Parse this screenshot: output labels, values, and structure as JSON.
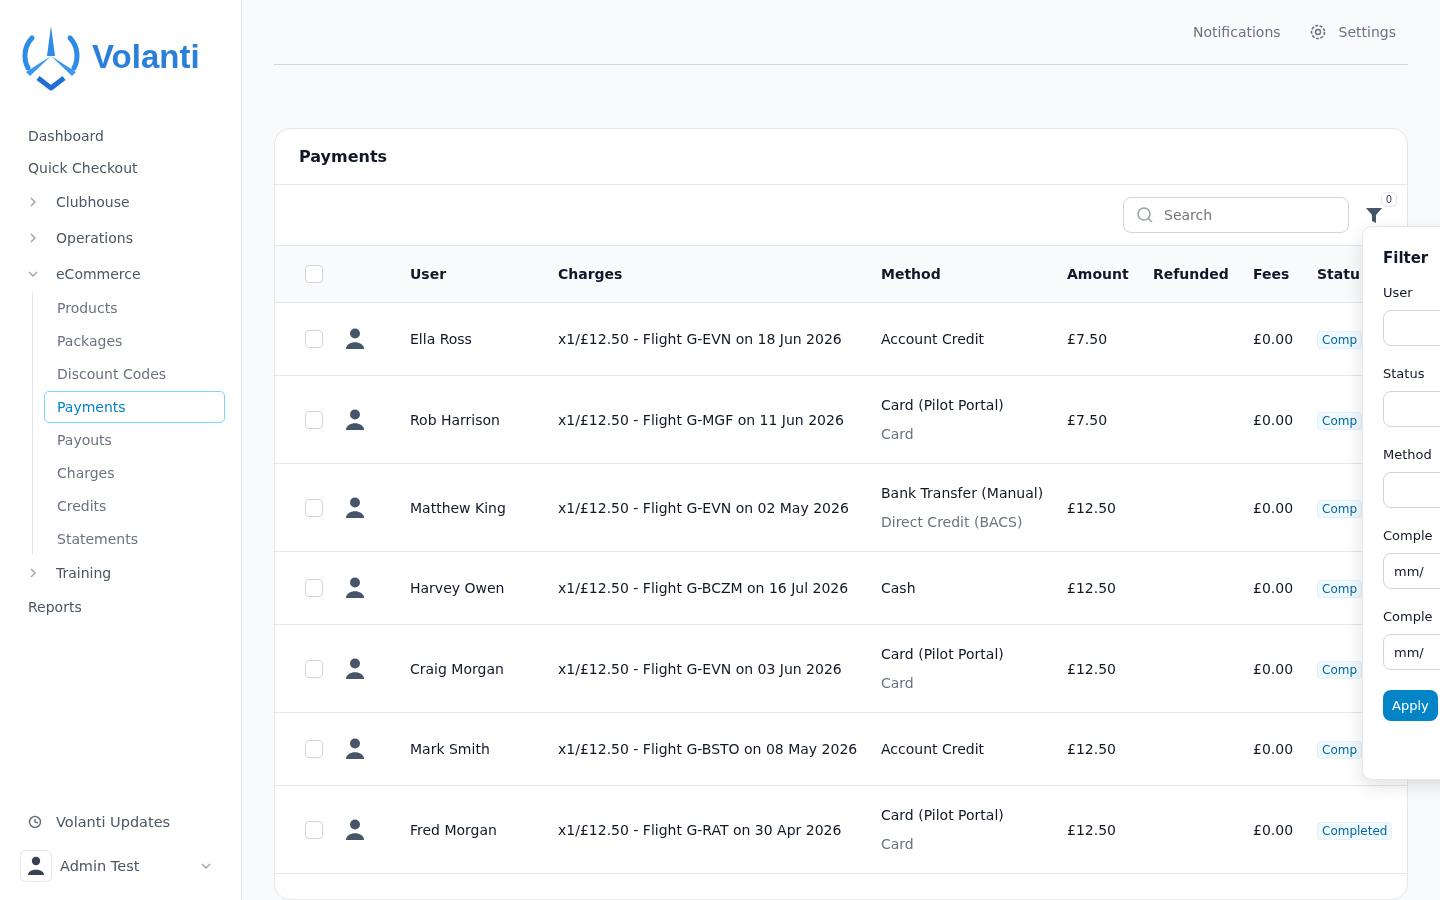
{
  "brand": {
    "name": "Volanti"
  },
  "topbar": {
    "links": [
      {
        "label": "Notifications",
        "kind": "plain"
      },
      {
        "label": "Settings",
        "kind": "gear"
      }
    ]
  },
  "sidebar": {
    "items": [
      {
        "label": "Dashboard",
        "kind": "link"
      },
      {
        "label": "Quick Checkout",
        "kind": "link"
      },
      {
        "label": "Clubhouse",
        "kind": "group",
        "expanded": false
      },
      {
        "label": "Operations",
        "kind": "group",
        "expanded": false
      },
      {
        "label": "eCommerce",
        "kind": "group",
        "expanded": true,
        "children": [
          {
            "label": "Products",
            "selected": false
          },
          {
            "label": "Packages",
            "selected": false
          },
          {
            "label": "Discount Codes",
            "selected": false
          },
          {
            "label": "Payments",
            "selected": true
          },
          {
            "label": "Payouts",
            "selected": false
          },
          {
            "label": "Charges",
            "selected": false
          },
          {
            "label": "Credits",
            "selected": false
          },
          {
            "label": "Statements",
            "selected": false
          }
        ]
      },
      {
        "label": "Training",
        "kind": "group",
        "expanded": false
      },
      {
        "label": "Reports",
        "kind": "link"
      }
    ],
    "updates": "Volanti Updates",
    "user": "Admin Test"
  },
  "card": {
    "title": "Payments",
    "search": {
      "placeholder": "Search"
    },
    "filter_count": "0"
  },
  "table": {
    "select_all": {
      "checked": false
    },
    "columns": [
      "User",
      "Charges",
      "Method",
      "Amount",
      "Refunded",
      "Fees",
      "Statu"
    ],
    "rows": [
      {
        "checked": false,
        "user": "Ella Ross",
        "charges": "x1/£12.50 - Flight G-EVN on 18 Jun 2026",
        "method": "Account Credit",
        "amount": "£7.50",
        "fees": "£0.00",
        "status": "Comp"
      },
      {
        "checked": false,
        "user": "Rob Harrison",
        "charges": "x1/£12.50 - Flight G-MGF on 11 Jun 2026",
        "method": "Card (Pilot Portal)",
        "method_detail": "Card",
        "amount": "£7.50",
        "fees": "£0.00",
        "status": "Comp"
      },
      {
        "checked": false,
        "user": "Matthew King",
        "charges": "x1/£12.50 - Flight G-EVN on 02 May 2026",
        "method": "Bank Transfer (Manual)",
        "method_detail": "Direct Credit (BACS)",
        "amount": "£12.50",
        "fees": "£0.00",
        "status": "Comp"
      },
      {
        "checked": false,
        "user": "Harvey Owen",
        "charges": "x1/£12.50 - Flight G-BCZM on 16 Jul 2026",
        "method": "Cash",
        "amount": "£12.50",
        "fees": "£0.00",
        "status": "Comp"
      },
      {
        "checked": false,
        "user": "Craig Morgan",
        "charges": "x1/£12.50 - Flight G-EVN on 03 Jun 2026",
        "method": "Card (Pilot Portal)",
        "method_detail": "Card",
        "amount": "£12.50",
        "fees": "£0.00",
        "status": "Comp"
      },
      {
        "checked": false,
        "user": "Mark Smith",
        "charges": "x1/£12.50 - Flight G-BSTO on 08 May 2026",
        "method": "Account Credit",
        "amount": "£12.50",
        "fees": "£0.00",
        "status": "Comp"
      },
      {
        "checked": false,
        "user": "Fred Morgan",
        "charges": "x1/£12.50 - Flight G-RAT on 30 Apr 2026",
        "method": "Card (Pilot Portal)",
        "method_detail": "Card",
        "amount": "£12.50",
        "fees": "£0.00",
        "status": "Completed"
      }
    ]
  },
  "filters": {
    "title": "Filter",
    "fields": [
      {
        "label": "User",
        "kind": "select"
      },
      {
        "label": "Status",
        "kind": "select"
      },
      {
        "label": "Method",
        "kind": "select"
      },
      {
        "label": "Comple",
        "kind": "date",
        "placeholder": "mm/"
      },
      {
        "label": "Comple",
        "kind": "date",
        "placeholder": "mm/"
      }
    ],
    "apply": "Apply"
  }
}
